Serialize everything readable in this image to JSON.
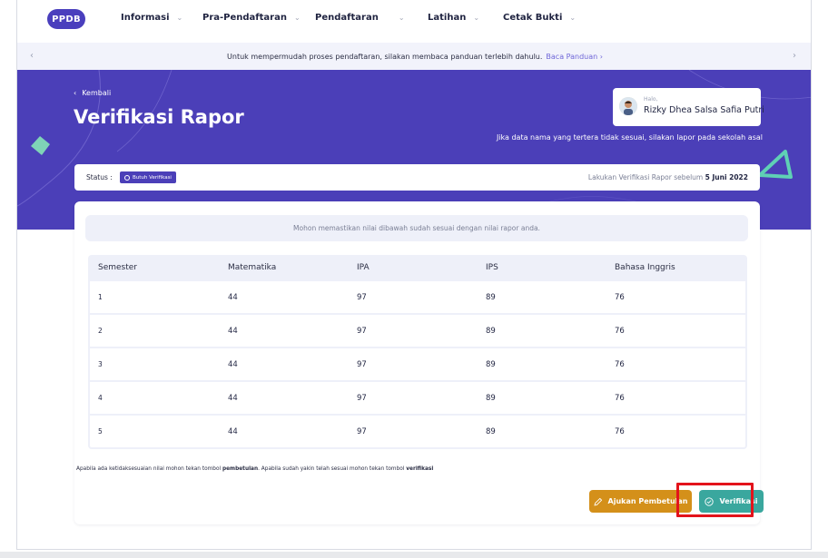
{
  "nav": {
    "logo": "PPDB",
    "items": [
      {
        "label": "Informasi",
        "chevron": "⌄"
      },
      {
        "label": "Pra-Pendaftaran",
        "chevron": "⌄"
      },
      {
        "label": "Pendaftaran",
        "chevron": "⌄"
      },
      {
        "label": "Latihan",
        "chevron": "⌄"
      },
      {
        "label": "Cetak Bukti",
        "chevron": "⌄"
      }
    ]
  },
  "banner": {
    "text": "Untuk mempermudah proses pendaftaran, silakan membaca panduan terlebih dahulu.",
    "link": "Baca Panduan ›",
    "prev": "‹",
    "next": "›"
  },
  "hero": {
    "back_label": "Kembali",
    "back_arrow": "‹",
    "title": "Verifikasi Rapor",
    "note": "Jika data nama yang tertera tidak sesuai, silakan lapor pada sekolah asal",
    "greeting": "Halo,",
    "user_name": "Rizky Dhea Salsa Safia Putri"
  },
  "status": {
    "label": "Status :",
    "badge": "Butuh Verifikasi",
    "deadline_prefix": "Lakukan Verifikasi Rapor sebelum",
    "deadline_date": "5 Juni 2022"
  },
  "card": {
    "info": "Mohon memastikan nilai dibawah sudah sesuai dengan nilai rapor anda.",
    "columns": [
      "Semester",
      "Matematika",
      "IPA",
      "IPS",
      "Bahasa Inggris"
    ],
    "rows": [
      [
        "1",
        "44",
        "97",
        "89",
        "76"
      ],
      [
        "2",
        "44",
        "97",
        "89",
        "76"
      ],
      [
        "3",
        "44",
        "97",
        "89",
        "76"
      ],
      [
        "4",
        "44",
        "97",
        "89",
        "76"
      ],
      [
        "5",
        "44",
        "97",
        "89",
        "76"
      ]
    ],
    "footnote_a": "Apabila ada ketidaksesuaian nilai mohon tekan tombol ",
    "footnote_b": "pembetulan",
    "footnote_c": ". Apabila sudah yakin telah sesuai mohon tekan tombol ",
    "footnote_d": "verifikasi",
    "btn_koreksi": "Ajukan Pembetulan",
    "btn_verif": "Verifikasi"
  },
  "colors": {
    "brand": "#4b3fb8",
    "koreksi": "#d4901a",
    "verif": "#3aa79e",
    "highlight": "#e3131b"
  }
}
